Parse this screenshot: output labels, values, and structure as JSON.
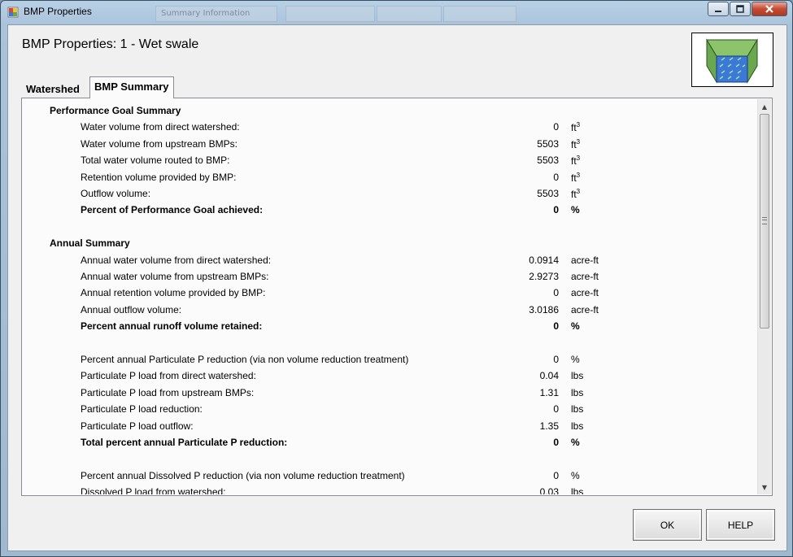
{
  "window": {
    "title": "BMP Properties"
  },
  "background_windows": [
    "Summary Information",
    "",
    "",
    ""
  ],
  "heading": "BMP Properties: 1 - Wet swale",
  "thumbnail": {
    "icon": "wet-swale-icon",
    "colors": {
      "green": "#6aa84f",
      "blue": "#3c78d8"
    }
  },
  "tabs": [
    {
      "label": "Watershed",
      "active": false
    },
    {
      "label": "BMP Summary",
      "active": true
    }
  ],
  "rows": [
    {
      "kind": "section",
      "label": "Performance Goal Summary"
    },
    {
      "kind": "item",
      "label": "Water volume from direct watershed:",
      "value": "0",
      "unit": "ft",
      "sup": "3"
    },
    {
      "kind": "item",
      "label": "Water volume from upstream BMPs:",
      "value": "5503",
      "unit": "ft",
      "sup": "3"
    },
    {
      "kind": "item",
      "label": "Total water volume routed to BMP:",
      "value": "5503",
      "unit": "ft",
      "sup": "3"
    },
    {
      "kind": "item",
      "label": "Retention volume provided by BMP:",
      "value": "0",
      "unit": "ft",
      "sup": "3"
    },
    {
      "kind": "item",
      "label": "Outflow volume:",
      "value": "5503",
      "unit": "ft",
      "sup": "3"
    },
    {
      "kind": "bold",
      "label": "Percent of Performance Goal achieved:",
      "value": "0",
      "unit": "%"
    },
    {
      "kind": "blank"
    },
    {
      "kind": "section",
      "label": "Annual Summary"
    },
    {
      "kind": "item",
      "label": "Annual water volume from direct watershed:",
      "value": "0.0914",
      "unit": "acre-ft"
    },
    {
      "kind": "item",
      "label": "Annual water volume from upstream BMPs:",
      "value": "2.9273",
      "unit": "acre-ft"
    },
    {
      "kind": "item",
      "label": "Annual retention volume provided by BMP:",
      "value": "0",
      "unit": "acre-ft"
    },
    {
      "kind": "item",
      "label": "Annual outflow volume:",
      "value": "3.0186",
      "unit": "acre-ft"
    },
    {
      "kind": "bold",
      "label": "Percent annual runoff volume retained:",
      "value": "0",
      "unit": "%"
    },
    {
      "kind": "blank"
    },
    {
      "kind": "item",
      "label": "Percent annual Particulate P reduction (via non volume reduction treatment)",
      "value": "0",
      "unit": "%"
    },
    {
      "kind": "item",
      "label": "Particulate P load from direct watershed:",
      "value": "0.04",
      "unit": "lbs"
    },
    {
      "kind": "item",
      "label": "Particulate P load from upstream BMPs:",
      "value": "1.31",
      "unit": "lbs"
    },
    {
      "kind": "item",
      "label": "Particulate P load reduction:",
      "value": "0",
      "unit": "lbs"
    },
    {
      "kind": "item",
      "label": "Particulate P load outflow:",
      "value": "1.35",
      "unit": "lbs"
    },
    {
      "kind": "bold",
      "label": "Total percent annual Particulate P reduction:",
      "value": "0",
      "unit": "%"
    },
    {
      "kind": "blank"
    },
    {
      "kind": "item",
      "label": "Percent annual Dissolved P reduction (via non volume reduction treatment)",
      "value": "0",
      "unit": "%"
    },
    {
      "kind": "item",
      "label": "Dissolved P load from watershed:",
      "value": "0.03",
      "unit": "lbs"
    }
  ],
  "buttons": {
    "ok": "OK",
    "help": "HELP"
  },
  "window_buttons": {
    "minimize": "minimize-icon",
    "maximize": "maximize-icon",
    "close": "close-icon"
  }
}
